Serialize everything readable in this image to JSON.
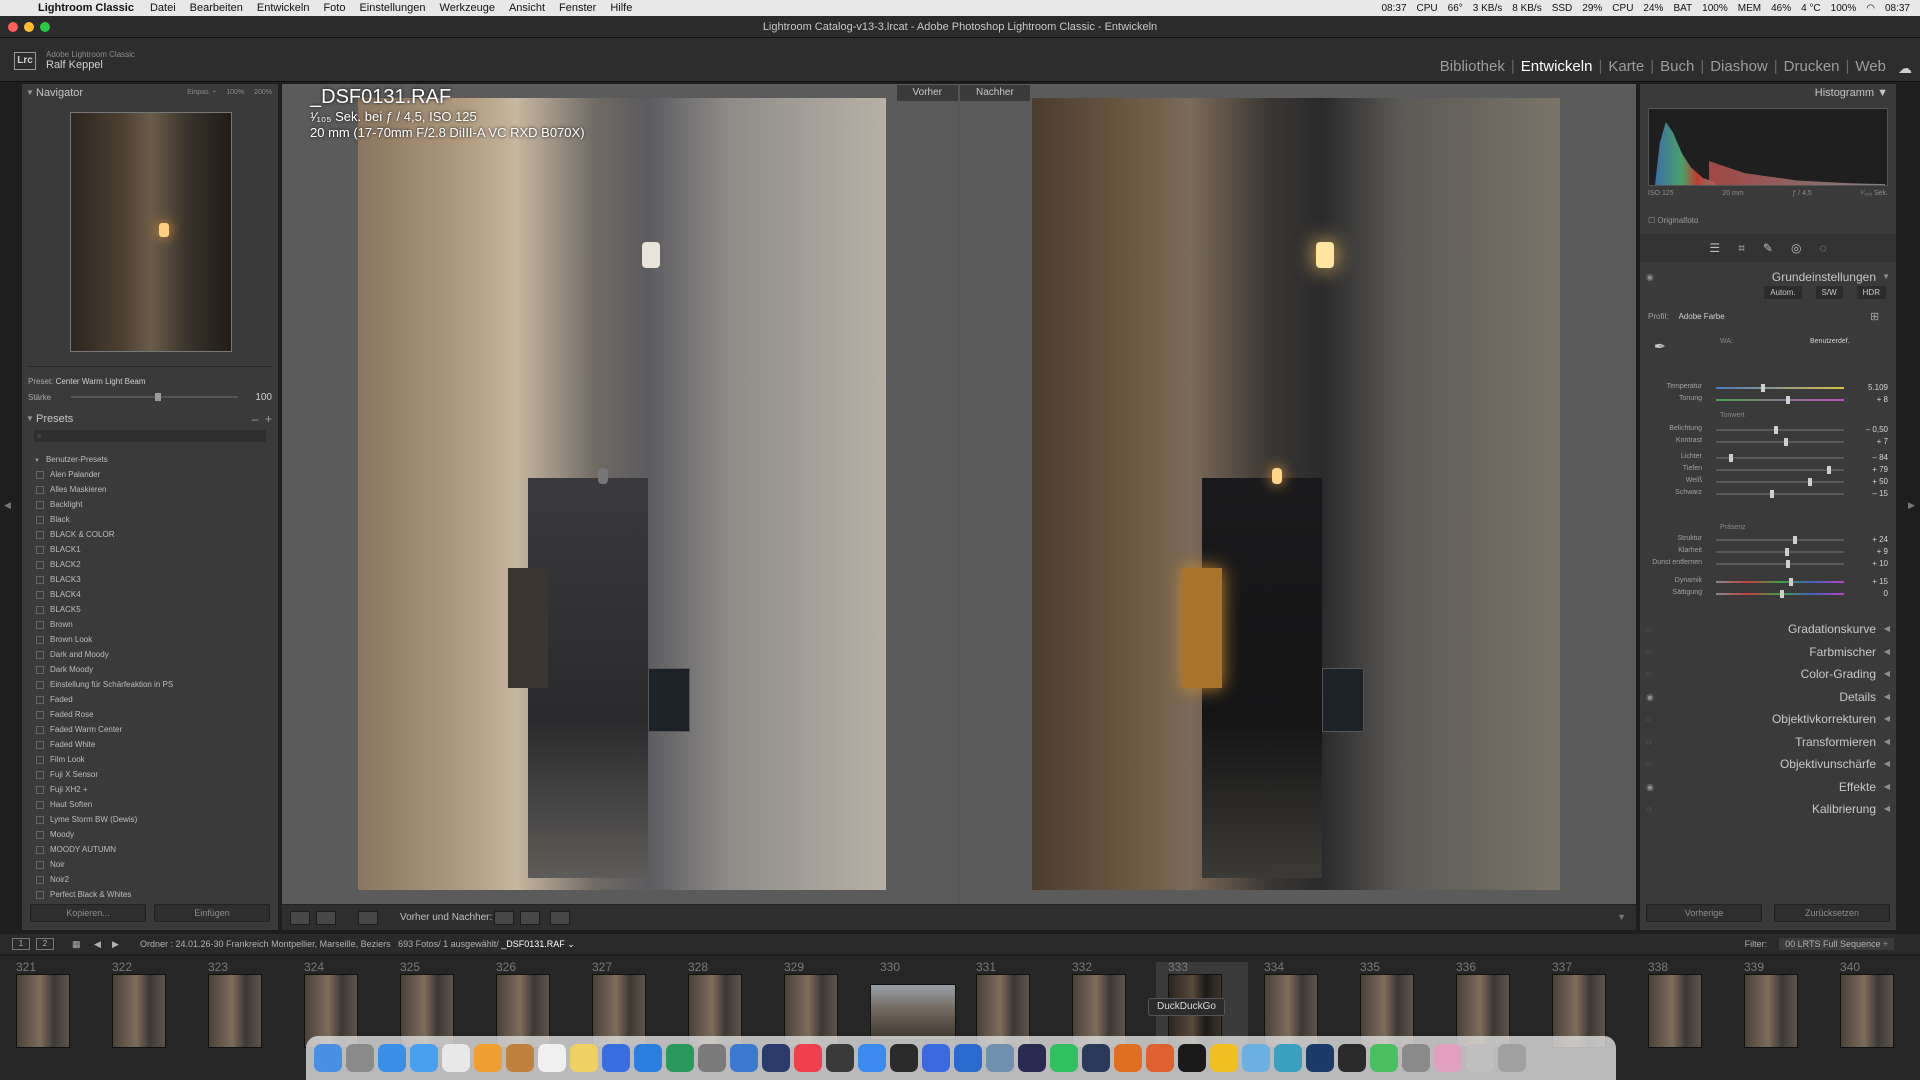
{
  "menubar": {
    "app": "Lightroom Classic",
    "items": [
      "Datei",
      "Bearbeiten",
      "Entwickeln",
      "Foto",
      "Einstellungen",
      "Werkzeuge",
      "Ansicht",
      "Fenster",
      "Hilfe"
    ],
    "time_left": "08:37",
    "cpu1_label": "CPU",
    "cpu1": "66°",
    "net_up": "3 KB/s",
    "net_down": "8 KB/s",
    "ssd_label": "SSD",
    "ssd": "29%",
    "cpu2_label": "CPU",
    "cpu2": "24%",
    "bat_label": "BAT",
    "bat": "100%",
    "mem_label": "MEM",
    "mem": "46%",
    "temp": "4 °C",
    "battery": "100%",
    "time_right": "08:37"
  },
  "window": {
    "title": "Lightroom Catalog-v13-3.lrcat - Adobe Photoshop Lightroom Classic - Entwickeln"
  },
  "identity": {
    "product": "Adobe Lightroom Classic",
    "user": "Ralf Keppel",
    "logo": "Lrc"
  },
  "modules": {
    "items": [
      "Bibliothek",
      "Entwickeln",
      "Karte",
      "Buch",
      "Diashow",
      "Drucken",
      "Web"
    ],
    "active": "Entwickeln"
  },
  "navigator": {
    "title": "Navigator",
    "zoom": [
      "Einpas. ÷",
      "100%",
      "200%"
    ]
  },
  "preset_info": {
    "preset_label": "Preset:",
    "preset_name": "Center Warm Light Beam",
    "amount_label": "Stärke",
    "amount_value": "100",
    "amount": 100
  },
  "presets": {
    "title": "Presets",
    "group": "Benutzer-Presets",
    "items": [
      "Alen Palander",
      "Alles Maskieren",
      "Backlight",
      "Black",
      "BLACK & COLOR",
      "BLACK1",
      "BLACK2",
      "BLACK3",
      "BLACK4",
      "BLACK5",
      "Brown",
      "Brown Look",
      "Dark and Moody",
      "Dark Moody",
      "Einstellung für Schärfeaktion in PS",
      "Faded",
      "Faded Rose",
      "Faded Warm Center",
      "Faded White",
      "Film Look",
      "Fuji X Sensor",
      "Fuji XH2  +",
      "Haut Soften",
      "Lyme Storm BW (Dewis)",
      "Moody",
      "MOODY AUTUMN",
      "Noir",
      "Noir2",
      "Perfect Black & Whites"
    ]
  },
  "left_buttons": {
    "copy": "Kopieren...",
    "paste": "Einfügen"
  },
  "views": {
    "before": "Vorher",
    "after": "Nachher"
  },
  "photo_info": {
    "filename": "_DSF0131.RAF",
    "exposure": "¹⁄₁₀₅ Sek. bei ƒ / 4,5, ISO 125",
    "lens": "20 mm (17-70mm F/2.8 DiIII-A VC RXD B070X)"
  },
  "toolbar": {
    "compare_label": "Vorher und Nachher:"
  },
  "histogram": {
    "title": "Histogramm",
    "iso": "ISO 125",
    "focal": "20 mm",
    "aperture": "ƒ / 4,5",
    "shutter": "¹⁄₁₀₅ Sek.",
    "original_photo": "Originalfoto"
  },
  "basic": {
    "title": "Grundeinstellungen",
    "auto": "Autom.",
    "bw": "S/W",
    "hdr": "HDR",
    "profile_label": "Profil:",
    "profile_value": "Adobe Farbe",
    "wb_label": "WA:",
    "wb_value": "Benutzerdef.",
    "tone_label": "Tonwert",
    "presence_label": "Präsenz",
    "sliders": [
      {
        "label": "Temperatur",
        "value": "5.109",
        "pos": 0.35
      },
      {
        "label": "Tonung",
        "value": "+ 8",
        "pos": 0.55
      },
      {
        "label": "Belichtung",
        "value": "– 0,50",
        "pos": 0.45
      },
      {
        "label": "Kontrast",
        "value": "+ 7",
        "pos": 0.53
      },
      {
        "label": "Lichter",
        "value": "– 84",
        "pos": 0.1
      },
      {
        "label": "Tiefen",
        "value": "+ 79",
        "pos": 0.87
      },
      {
        "label": "Weiß",
        "value": "+ 50",
        "pos": 0.72
      },
      {
        "label": "Schwarz",
        "value": "– 15",
        "pos": 0.42
      },
      {
        "label": "Struktur",
        "value": "+ 24",
        "pos": 0.6
      },
      {
        "label": "Klarheit",
        "value": "+ 9",
        "pos": 0.54
      },
      {
        "label": "Dunst entfernen",
        "value": "+ 10",
        "pos": 0.55
      },
      {
        "label": "Dynamik",
        "value": "+ 15",
        "pos": 0.57
      },
      {
        "label": "Sättigung",
        "value": "0",
        "pos": 0.5
      }
    ]
  },
  "sections": [
    "Gradationskurve",
    "Farbmischer",
    "Color-Grading",
    "Details",
    "Objektivkorrekturen",
    "Transformieren",
    "Objektivunschärfe",
    "Effekte",
    "Kalibrierung"
  ],
  "right_buttons": {
    "previous": "Vorherige",
    "reset": "Zurücksetzen"
  },
  "filmbar": {
    "screen1": "1",
    "screen2": "2",
    "source_label": "Ordner : 24.01.26-30 Frankreich Montpellier, Marseille, Beziers",
    "count": "693 Fotos/ 1 ausgewählt/",
    "selected_file": "_DSF0131.RAF ⌄",
    "filter_label": "Filter:",
    "filter_value": "00 LRTS Full Sequence ÷"
  },
  "filmstrip": {
    "numbers": [
      "321",
      "322",
      "323",
      "324",
      "325",
      "326",
      "327",
      "328",
      "329",
      "330",
      "331",
      "332",
      "333",
      "334",
      "335",
      "336",
      "337",
      "338",
      "339",
      "340"
    ],
    "selected": "333"
  },
  "dock": {
    "tooltip": "DuckDuckGo"
  },
  "colors": {
    "accent_active": "#ffffff",
    "panel": "#3a3a3a",
    "center_bg": "#565656"
  }
}
